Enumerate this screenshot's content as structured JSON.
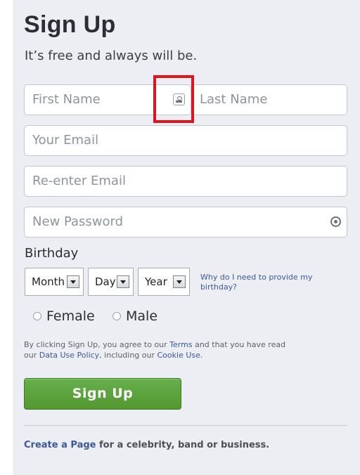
{
  "header": {
    "title": "Sign Up",
    "subtitle": "It’s free and always will be."
  },
  "form": {
    "first_name_placeholder": "First Name",
    "last_name_placeholder": "Last Name",
    "email_placeholder": "Your Email",
    "reenter_email_placeholder": "Re-enter Email",
    "password_placeholder": "New Password",
    "contact_icon": "contact-card-icon",
    "password_icon": "password-strength-icon"
  },
  "birthday": {
    "label": "Birthday",
    "month": "Month",
    "day": "Day",
    "year": "Year",
    "why_link": "Why do I need to provide my birthday?"
  },
  "gender": {
    "female": "Female",
    "male": "Male"
  },
  "terms": {
    "part1": "By clicking Sign Up, you agree to our ",
    "terms_link": "Terms",
    "part2": " and that you have read our ",
    "data_policy_link": "Data Use Policy",
    "part3": ", including our ",
    "cookie_link": "Cookie Use",
    "part4": "."
  },
  "submit": {
    "label": "Sign Up"
  },
  "footer": {
    "link": "Create a Page",
    "text": " for a celebrity, band or business."
  },
  "colors": {
    "panel_bg": "#eceef3",
    "link": "#3b5998",
    "button_green": "#5ca33f",
    "highlight": "#e2141b"
  }
}
